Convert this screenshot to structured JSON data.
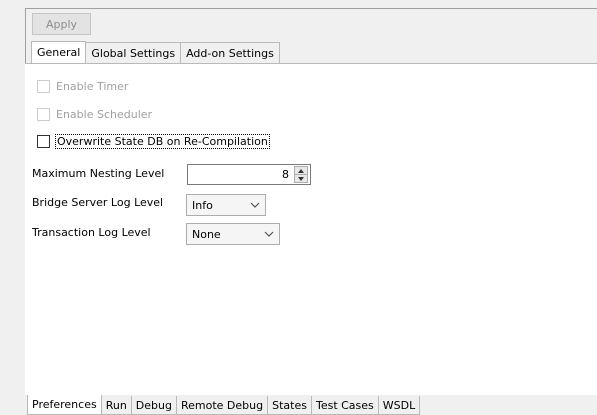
{
  "toolbar": {
    "apply_label": "Apply"
  },
  "top_tabs": [
    {
      "label": "General",
      "active": true
    },
    {
      "label": "Global Settings",
      "active": false
    },
    {
      "label": "Add-on Settings",
      "active": false
    }
  ],
  "general": {
    "enable_timer": {
      "label": "Enable Timer",
      "checked": false,
      "enabled": false
    },
    "enable_scheduler": {
      "label": "Enable Scheduler",
      "checked": false,
      "enabled": false
    },
    "overwrite_state_db": {
      "label": "Overwrite State DB on Re-Compilation",
      "checked": false,
      "enabled": true,
      "focused": true
    },
    "max_nesting": {
      "label": "Maximum Nesting Level",
      "value": "8"
    },
    "bridge_log": {
      "label": "Bridge Server Log Level",
      "value": "Info"
    },
    "transaction_log": {
      "label": "Transaction Log Level",
      "value": "None"
    }
  },
  "bottom_tabs": [
    {
      "label": "Preferences",
      "active": true
    },
    {
      "label": "Run",
      "active": false
    },
    {
      "label": "Debug",
      "active": false
    },
    {
      "label": "Remote Debug",
      "active": false
    },
    {
      "label": "States",
      "active": false
    },
    {
      "label": "Test Cases",
      "active": false
    },
    {
      "label": "WSDL",
      "active": false
    }
  ],
  "icons": {
    "spinner_up": "triangle-up-icon",
    "spinner_down": "triangle-down-icon",
    "dropdown": "chevron-down-icon"
  }
}
